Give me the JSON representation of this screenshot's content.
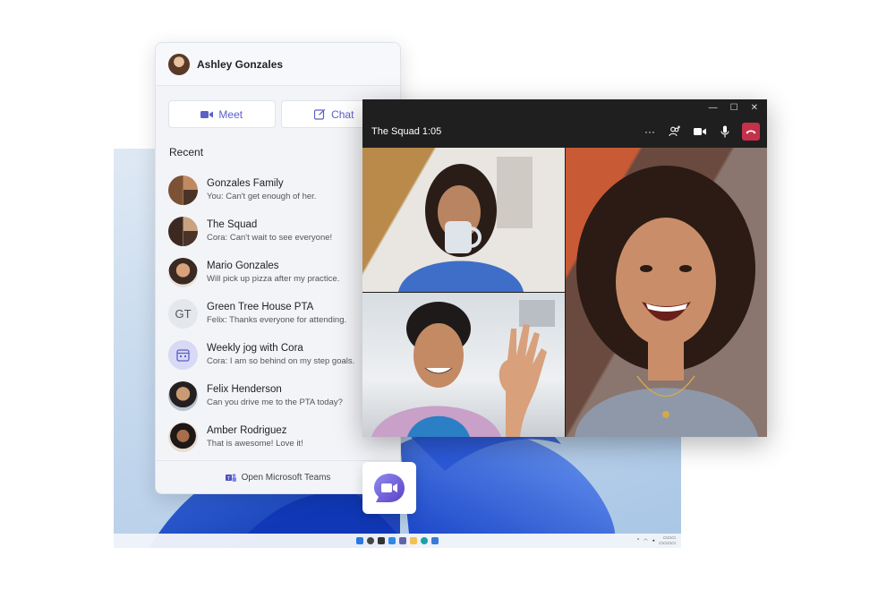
{
  "flyout": {
    "user_name": "Ashley Gonzales",
    "meet_label": "Meet",
    "chat_label": "Chat",
    "recent_label": "Recent",
    "footer_label": "Open Microsoft Teams",
    "chats": [
      {
        "name": "Gonzales Family",
        "preview": "You: Can't get enough of her.",
        "avatar": "group-photo"
      },
      {
        "name": "The Squad",
        "preview": "Cora: Can't wait to see everyone!",
        "avatar": "group-photo"
      },
      {
        "name": "Mario Gonzales",
        "preview": "Will pick up pizza after my practice.",
        "avatar": "person-photo"
      },
      {
        "name": "Green Tree House PTA",
        "preview": "Felix: Thanks everyone for attending.",
        "avatar": "GT"
      },
      {
        "name": "Weekly jog with Cora",
        "preview": "Cora: I am so behind on my step goals.",
        "avatar": "calendar-icon"
      },
      {
        "name": "Felix Henderson",
        "preview": "Can you drive me to the PTA today?",
        "avatar": "person-photo"
      },
      {
        "name": "Amber Rodriguez",
        "preview": "That is awesome! Love it!",
        "avatar": "person-photo"
      }
    ]
  },
  "call": {
    "title": "The Squad 1:05",
    "controls": [
      "more-icon",
      "add-people-icon",
      "camera-icon",
      "mic-icon",
      "hang-up-icon"
    ],
    "participants": [
      "participant-woman-mug",
      "participant-man-waving",
      "participant-woman-laughing"
    ]
  },
  "colors": {
    "teams_purple": "#5b5fc7",
    "hangup_red": "#c4314b",
    "call_bg": "#1f1f1f",
    "flyout_bg": "#f2f4f8"
  }
}
